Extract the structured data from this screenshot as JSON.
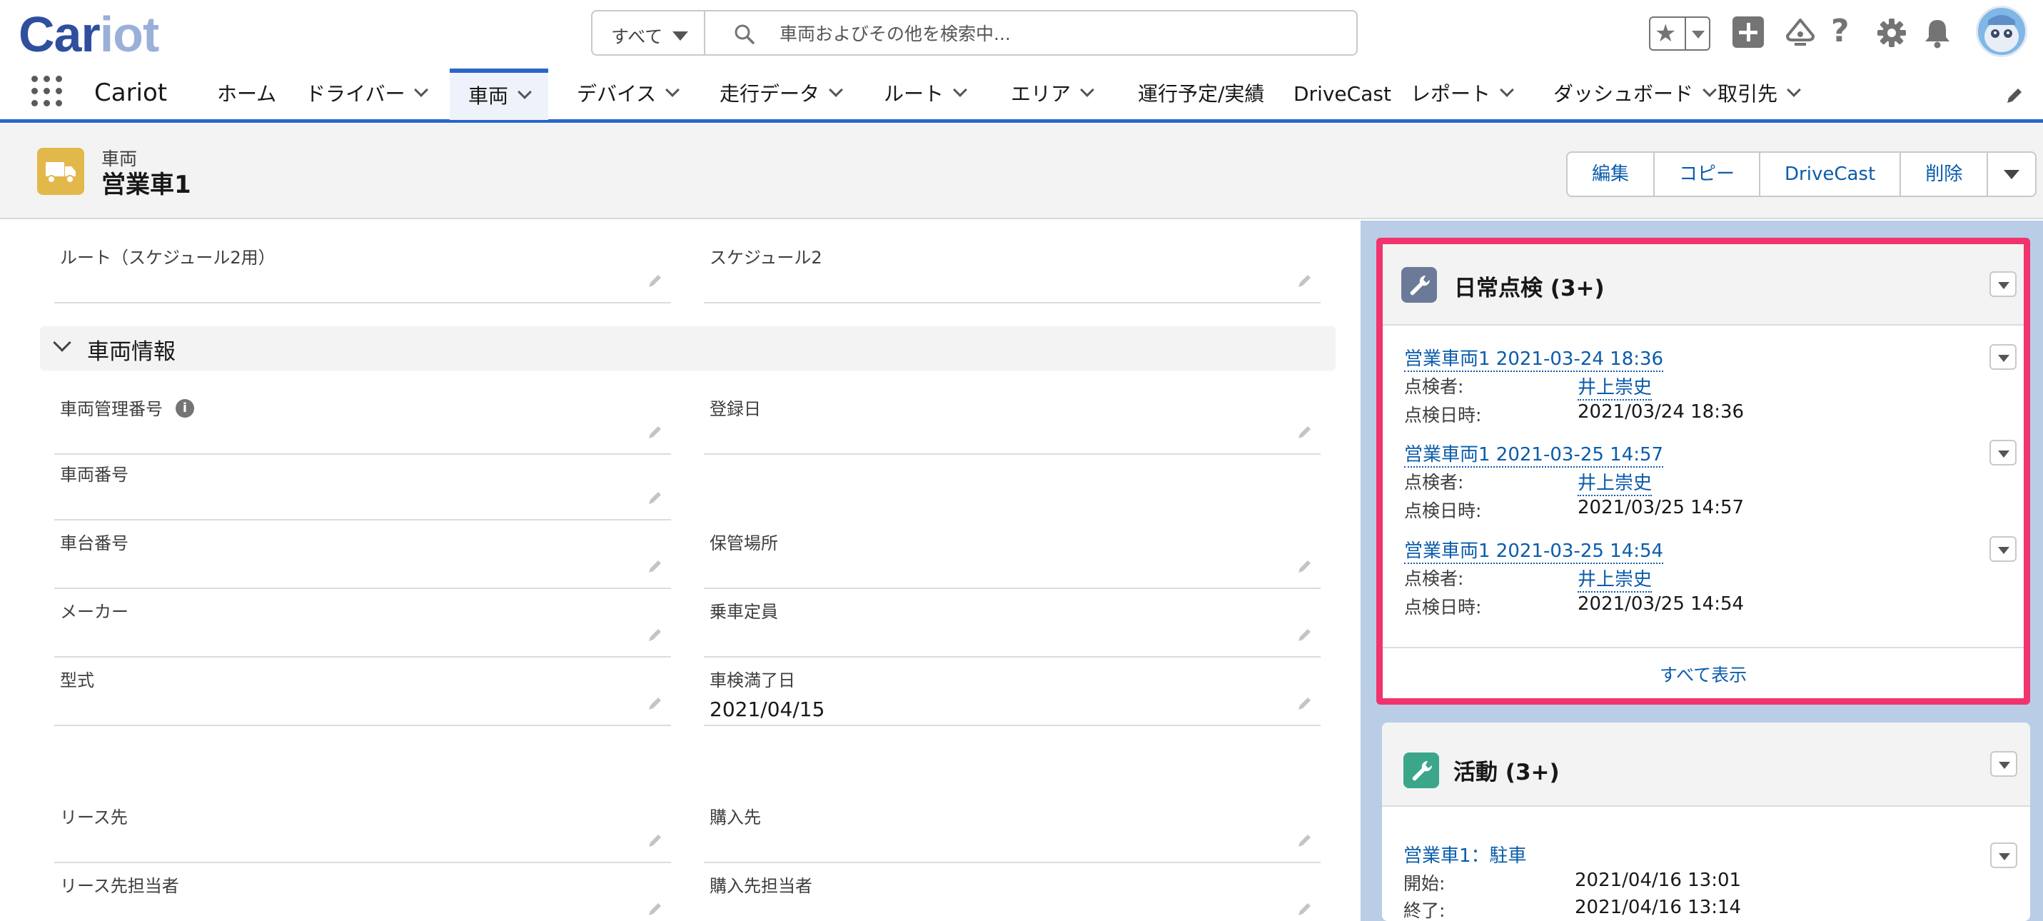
{
  "header": {
    "logo_main": "Car",
    "logo_light": "iot",
    "search_scope": "すべて",
    "search_placeholder": "車両およびその他を検索中..."
  },
  "nav": {
    "app_name": "Cariot",
    "items": [
      {
        "label": "ホーム",
        "dropdown": false
      },
      {
        "label": "ドライバー",
        "dropdown": true
      },
      {
        "label": "車両",
        "dropdown": true,
        "active": true
      },
      {
        "label": "デバイス",
        "dropdown": true
      },
      {
        "label": "走行データ",
        "dropdown": true
      },
      {
        "label": "ルート",
        "dropdown": true
      },
      {
        "label": "エリア",
        "dropdown": true
      },
      {
        "label": "運行予定/実績",
        "dropdown": false
      },
      {
        "label": "DriveCast",
        "dropdown": false
      },
      {
        "label": "レポート",
        "dropdown": true
      },
      {
        "label": "ダッシュボード",
        "dropdown": true
      },
      {
        "label": "取引先",
        "dropdown": true
      }
    ]
  },
  "record": {
    "object_label": "車両",
    "title": "営業車1",
    "actions": [
      "編集",
      "コピー",
      "DriveCast",
      "削除"
    ]
  },
  "fields": {
    "route2": {
      "label": "ルート（スケジュール2用）",
      "value": ""
    },
    "schedule2": {
      "label": "スケジュール2",
      "value": ""
    },
    "section_title": "車両情報",
    "mgmt_no": {
      "label": "車両管理番号",
      "value": ""
    },
    "reg_date": {
      "label": "登録日",
      "value": ""
    },
    "vehicle_no": {
      "label": "車両番号",
      "value": ""
    },
    "chassis_no": {
      "label": "車台番号",
      "value": ""
    },
    "storage": {
      "label": "保管場所",
      "value": ""
    },
    "maker": {
      "label": "メーカー",
      "value": ""
    },
    "capacity": {
      "label": "乗車定員",
      "value": ""
    },
    "model": {
      "label": "型式",
      "value": ""
    },
    "inspection_expiry": {
      "label": "車検満了日",
      "value": "2021/04/15"
    },
    "lessor": {
      "label": "リース先",
      "value": ""
    },
    "purchase_from": {
      "label": "購入先",
      "value": ""
    },
    "lessor_contact": {
      "label": "リース先担当者",
      "value": ""
    },
    "purchase_contact": {
      "label": "購入先担当者",
      "value": ""
    }
  },
  "inspection": {
    "title": "日常点検 (3+)",
    "inspector_label": "点検者:",
    "datetime_label": "点検日時:",
    "records": [
      {
        "name": "営業車両1 2021-03-24 18:36",
        "inspector": "井上崇史",
        "datetime": "2021/03/24 18:36"
      },
      {
        "name": "営業車両1 2021-03-25 14:57",
        "inspector": "井上崇史",
        "datetime": "2021/03/25 14:57"
      },
      {
        "name": "営業車両1 2021-03-25 14:54",
        "inspector": "井上崇史",
        "datetime": "2021/03/25 14:54"
      }
    ],
    "view_all": "すべて表示"
  },
  "activity": {
    "title": "活動 (3+)",
    "record_name": "営業車1：駐車",
    "start_label": "開始:",
    "start_value": "2021/04/16 13:01",
    "end_label": "終了:",
    "end_value": "2021/04/16 13:14"
  },
  "colors": {
    "brand_blue": "#2a66c7",
    "link": "#0b5cab",
    "highlight_border": "#f2336e",
    "vehicle_icon": "#e3b84b",
    "inspection_icon": "#6b7a99",
    "activity_icon": "#3ba68a"
  }
}
